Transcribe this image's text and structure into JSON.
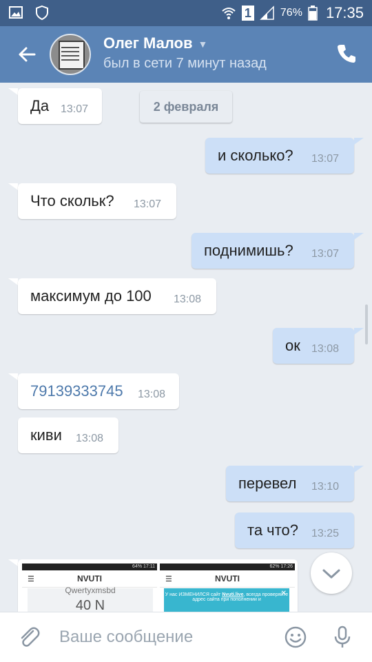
{
  "statusbar": {
    "battery": "76%",
    "time": "17:35",
    "sim_slot": "1"
  },
  "header": {
    "contact_name": "Олег Малов",
    "presence": "был в сети 7 минут назад"
  },
  "date_separator": "2 февраля",
  "messages": [
    {
      "direction": "in",
      "text": "Да",
      "time": "13:07"
    },
    {
      "direction": "out",
      "text": "и сколько?",
      "time": "13:07"
    },
    {
      "direction": "in",
      "text": "Что скольк?",
      "time": "13:07"
    },
    {
      "direction": "out",
      "text": "поднимишь?",
      "time": "13:07"
    },
    {
      "direction": "in",
      "text": "максимум до 100",
      "time": "13:08"
    },
    {
      "direction": "out",
      "text": "ок",
      "time": "13:08"
    },
    {
      "direction": "in",
      "text": "79139333745",
      "time": "13:08",
      "link": true
    },
    {
      "direction": "in",
      "text": "киви",
      "time": "13:08"
    },
    {
      "direction": "out",
      "text": "перевел",
      "time": "13:10"
    },
    {
      "direction": "out",
      "text": "та что?",
      "time": "13:25"
    }
  ],
  "attachment": {
    "left_shot": {
      "status": "64% 17:11",
      "title": "NVUTI",
      "user": "Qwertyxmsbd",
      "amount": "40 N"
    },
    "right_shot": {
      "status": "62% 17:26",
      "title": "NVUTI",
      "notice_prefix": "У нас ИЗМЕНИЛСЯ сайт",
      "notice_site": "Nvuti.live",
      "notice_rest": ", всегда проверяйте адрес сайта при пополнении и"
    }
  },
  "composer": {
    "placeholder": "Ваше сообщение"
  },
  "colors": {
    "statusbar": "#3f5f89",
    "appbar": "#5b84b6",
    "background": "#e9edf2",
    "outgoing_bubble": "#ccdff7",
    "link": "#4d79ab"
  },
  "icons": [
    "gallery-icon",
    "shield-icon",
    "wifi-icon",
    "signal-icon",
    "battery-icon",
    "back-arrow-icon",
    "chevron-down-icon",
    "phone-icon",
    "scroll-down-icon",
    "attach-icon",
    "smiley-icon",
    "microphone-icon"
  ]
}
